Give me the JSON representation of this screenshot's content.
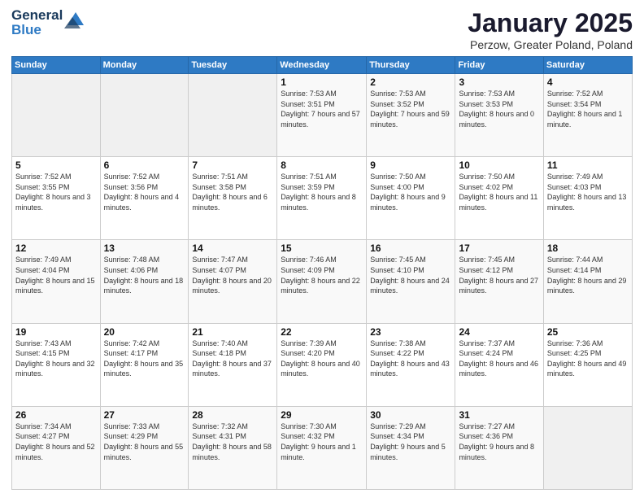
{
  "logo": {
    "line1": "General",
    "line2": "Blue"
  },
  "title": "January 2025",
  "subtitle": "Perzow, Greater Poland, Poland",
  "days_header": [
    "Sunday",
    "Monday",
    "Tuesday",
    "Wednesday",
    "Thursday",
    "Friday",
    "Saturday"
  ],
  "weeks": [
    [
      {
        "day": "",
        "content": ""
      },
      {
        "day": "",
        "content": ""
      },
      {
        "day": "",
        "content": ""
      },
      {
        "day": "1",
        "content": "Sunrise: 7:53 AM\nSunset: 3:51 PM\nDaylight: 7 hours and 57 minutes."
      },
      {
        "day": "2",
        "content": "Sunrise: 7:53 AM\nSunset: 3:52 PM\nDaylight: 7 hours and 59 minutes."
      },
      {
        "day": "3",
        "content": "Sunrise: 7:53 AM\nSunset: 3:53 PM\nDaylight: 8 hours and 0 minutes."
      },
      {
        "day": "4",
        "content": "Sunrise: 7:52 AM\nSunset: 3:54 PM\nDaylight: 8 hours and 1 minute."
      }
    ],
    [
      {
        "day": "5",
        "content": "Sunrise: 7:52 AM\nSunset: 3:55 PM\nDaylight: 8 hours and 3 minutes."
      },
      {
        "day": "6",
        "content": "Sunrise: 7:52 AM\nSunset: 3:56 PM\nDaylight: 8 hours and 4 minutes."
      },
      {
        "day": "7",
        "content": "Sunrise: 7:51 AM\nSunset: 3:58 PM\nDaylight: 8 hours and 6 minutes."
      },
      {
        "day": "8",
        "content": "Sunrise: 7:51 AM\nSunset: 3:59 PM\nDaylight: 8 hours and 8 minutes."
      },
      {
        "day": "9",
        "content": "Sunrise: 7:50 AM\nSunset: 4:00 PM\nDaylight: 8 hours and 9 minutes."
      },
      {
        "day": "10",
        "content": "Sunrise: 7:50 AM\nSunset: 4:02 PM\nDaylight: 8 hours and 11 minutes."
      },
      {
        "day": "11",
        "content": "Sunrise: 7:49 AM\nSunset: 4:03 PM\nDaylight: 8 hours and 13 minutes."
      }
    ],
    [
      {
        "day": "12",
        "content": "Sunrise: 7:49 AM\nSunset: 4:04 PM\nDaylight: 8 hours and 15 minutes."
      },
      {
        "day": "13",
        "content": "Sunrise: 7:48 AM\nSunset: 4:06 PM\nDaylight: 8 hours and 18 minutes."
      },
      {
        "day": "14",
        "content": "Sunrise: 7:47 AM\nSunset: 4:07 PM\nDaylight: 8 hours and 20 minutes."
      },
      {
        "day": "15",
        "content": "Sunrise: 7:46 AM\nSunset: 4:09 PM\nDaylight: 8 hours and 22 minutes."
      },
      {
        "day": "16",
        "content": "Sunrise: 7:45 AM\nSunset: 4:10 PM\nDaylight: 8 hours and 24 minutes."
      },
      {
        "day": "17",
        "content": "Sunrise: 7:45 AM\nSunset: 4:12 PM\nDaylight: 8 hours and 27 minutes."
      },
      {
        "day": "18",
        "content": "Sunrise: 7:44 AM\nSunset: 4:14 PM\nDaylight: 8 hours and 29 minutes."
      }
    ],
    [
      {
        "day": "19",
        "content": "Sunrise: 7:43 AM\nSunset: 4:15 PM\nDaylight: 8 hours and 32 minutes."
      },
      {
        "day": "20",
        "content": "Sunrise: 7:42 AM\nSunset: 4:17 PM\nDaylight: 8 hours and 35 minutes."
      },
      {
        "day": "21",
        "content": "Sunrise: 7:40 AM\nSunset: 4:18 PM\nDaylight: 8 hours and 37 minutes."
      },
      {
        "day": "22",
        "content": "Sunrise: 7:39 AM\nSunset: 4:20 PM\nDaylight: 8 hours and 40 minutes."
      },
      {
        "day": "23",
        "content": "Sunrise: 7:38 AM\nSunset: 4:22 PM\nDaylight: 8 hours and 43 minutes."
      },
      {
        "day": "24",
        "content": "Sunrise: 7:37 AM\nSunset: 4:24 PM\nDaylight: 8 hours and 46 minutes."
      },
      {
        "day": "25",
        "content": "Sunrise: 7:36 AM\nSunset: 4:25 PM\nDaylight: 8 hours and 49 minutes."
      }
    ],
    [
      {
        "day": "26",
        "content": "Sunrise: 7:34 AM\nSunset: 4:27 PM\nDaylight: 8 hours and 52 minutes."
      },
      {
        "day": "27",
        "content": "Sunrise: 7:33 AM\nSunset: 4:29 PM\nDaylight: 8 hours and 55 minutes."
      },
      {
        "day": "28",
        "content": "Sunrise: 7:32 AM\nSunset: 4:31 PM\nDaylight: 8 hours and 58 minutes."
      },
      {
        "day": "29",
        "content": "Sunrise: 7:30 AM\nSunset: 4:32 PM\nDaylight: 9 hours and 1 minute."
      },
      {
        "day": "30",
        "content": "Sunrise: 7:29 AM\nSunset: 4:34 PM\nDaylight: 9 hours and 5 minutes."
      },
      {
        "day": "31",
        "content": "Sunrise: 7:27 AM\nSunset: 4:36 PM\nDaylight: 9 hours and 8 minutes."
      },
      {
        "day": "",
        "content": ""
      }
    ]
  ]
}
